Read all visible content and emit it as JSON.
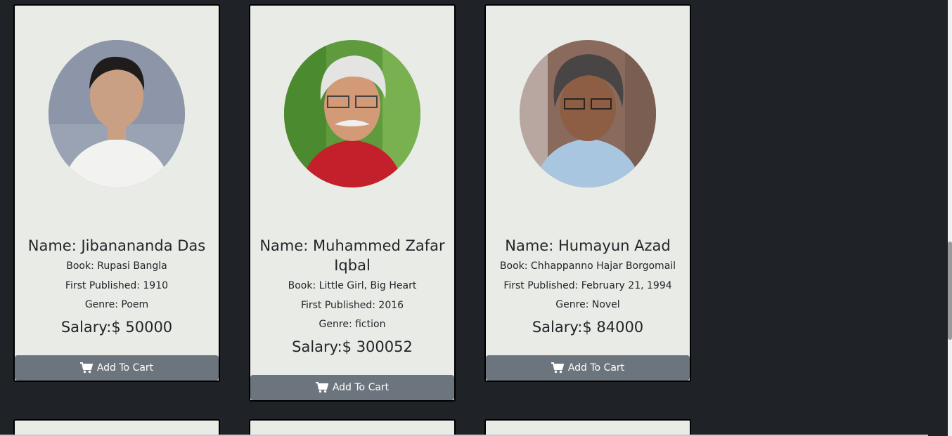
{
  "cards": [
    {
      "name": "Name: Jibanananda Das",
      "book": "Book: Rupasi Bangla",
      "published": "First Published: 1910",
      "genre": "Genre: Poem",
      "salary": "Salary:$ 50000",
      "button": "Add To Cart"
    },
    {
      "name": "Name: Muhammed Zafar Iqbal",
      "book": "Book: Little Girl, Big Heart",
      "published": "First Published: 2016",
      "genre": "Genre: fiction",
      "salary": "Salary:$ 300052",
      "button": "Add To Cart"
    },
    {
      "name": "Name: Humayun Azad",
      "book": "Book: Chhappanno Hajar Borgomail",
      "published": "First Published: February 21, 1994",
      "genre": "Genre: Novel",
      "salary": "Salary:$ 84000",
      "button": "Add To Cart"
    }
  ],
  "icons": {
    "cart": "shopping-cart-icon"
  },
  "colors": {
    "background": "#212529",
    "card": "#e9ebe6",
    "button": "#6c757d"
  }
}
